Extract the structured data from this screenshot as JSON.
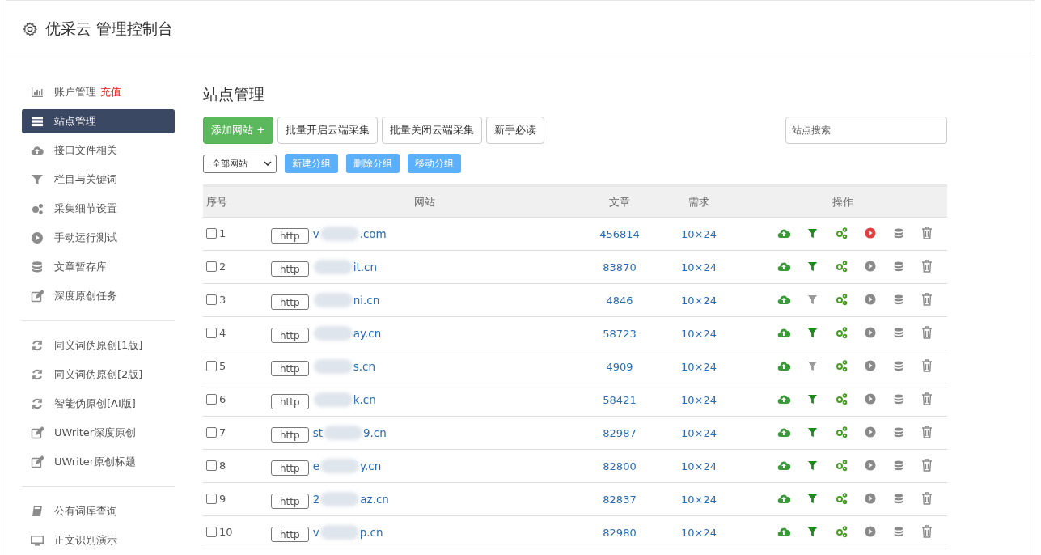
{
  "header": {
    "title": "优采云 管理控制台"
  },
  "sidebar": {
    "groups": [
      [
        {
          "label": "账户管理",
          "extra": "充值",
          "selected": false
        },
        {
          "label": "站点管理",
          "selected": true
        },
        {
          "label": "接口文件相关",
          "selected": false
        },
        {
          "label": "栏目与关键词",
          "selected": false
        },
        {
          "label": "采集细节设置",
          "selected": false
        },
        {
          "label": "手动运行测试",
          "selected": false
        },
        {
          "label": "文章暂存库",
          "selected": false
        },
        {
          "label": "深度原创任务",
          "selected": false
        }
      ],
      [
        {
          "label": "同义词伪原创[1版]",
          "selected": false
        },
        {
          "label": "同义词伪原创[2版]",
          "selected": false
        },
        {
          "label": "智能伪原创[AI版]",
          "selected": false
        },
        {
          "label": "UWriter深度原创",
          "selected": false
        },
        {
          "label": "UWriter原创标题",
          "selected": false
        }
      ],
      [
        {
          "label": "公有词库查询",
          "selected": false
        },
        {
          "label": "正文识别演示",
          "selected": false
        }
      ]
    ]
  },
  "main": {
    "title": "站点管理",
    "toolbar": [
      {
        "label": "添加网站 +",
        "kind": "primary"
      },
      {
        "label": "批量开启云端采集",
        "kind": "default"
      },
      {
        "label": "批量关闭云端采集",
        "kind": "default"
      },
      {
        "label": "新手必读",
        "kind": "default"
      }
    ],
    "search": {
      "placeholder": "站点搜索"
    },
    "group_select": {
      "value": "全部网站"
    },
    "group_buttons": [
      "新建分组",
      "删除分组",
      "移动分组"
    ],
    "table": {
      "columns": [
        "序号",
        "网站",
        "文章",
        "需求",
        "操作"
      ],
      "rows": [
        {
          "checked": false,
          "no": "1",
          "scheme": "http",
          "url_start": "v",
          "url_end": ".com",
          "articles": "456814",
          "demand": "10×24",
          "filter_on": true,
          "running": true
        },
        {
          "checked": false,
          "no": "2",
          "scheme": "http",
          "url_start": "",
          "url_end": "it.cn",
          "articles": "83870",
          "demand": "10×24",
          "filter_on": true,
          "running": false
        },
        {
          "checked": false,
          "no": "3",
          "scheme": "http",
          "url_start": "",
          "url_end": "ni.cn",
          "articles": "4846",
          "demand": "10×24",
          "filter_on": false,
          "running": false
        },
        {
          "checked": false,
          "no": "4",
          "scheme": "http",
          "url_start": "",
          "url_end": "ay.cn",
          "articles": "58723",
          "demand": "10×24",
          "filter_on": true,
          "running": false
        },
        {
          "checked": false,
          "no": "5",
          "scheme": "http",
          "url_start": "",
          "url_end": "s.cn",
          "articles": "4909",
          "demand": "10×24",
          "filter_on": false,
          "running": false
        },
        {
          "checked": false,
          "no": "6",
          "scheme": "http",
          "url_start": "",
          "url_end": "k.cn",
          "articles": "58421",
          "demand": "10×24",
          "filter_on": true,
          "running": false
        },
        {
          "checked": false,
          "no": "7",
          "scheme": "http",
          "url_start": "st",
          "url_end": "9.cn",
          "articles": "82987",
          "demand": "10×24",
          "filter_on": true,
          "running": false
        },
        {
          "checked": false,
          "no": "8",
          "scheme": "http",
          "url_start": "e",
          "url_end": "y.cn",
          "articles": "82800",
          "demand": "10×24",
          "filter_on": true,
          "running": false
        },
        {
          "checked": false,
          "no": "9",
          "scheme": "http",
          "url_start": "2",
          "url_end": "az.cn",
          "articles": "82837",
          "demand": "10×24",
          "filter_on": true,
          "running": false
        },
        {
          "checked": false,
          "no": "10",
          "scheme": "http",
          "url_start": "v",
          "url_end": "p.cn",
          "articles": "82980",
          "demand": "10×24",
          "filter_on": true,
          "running": false
        }
      ]
    }
  }
}
